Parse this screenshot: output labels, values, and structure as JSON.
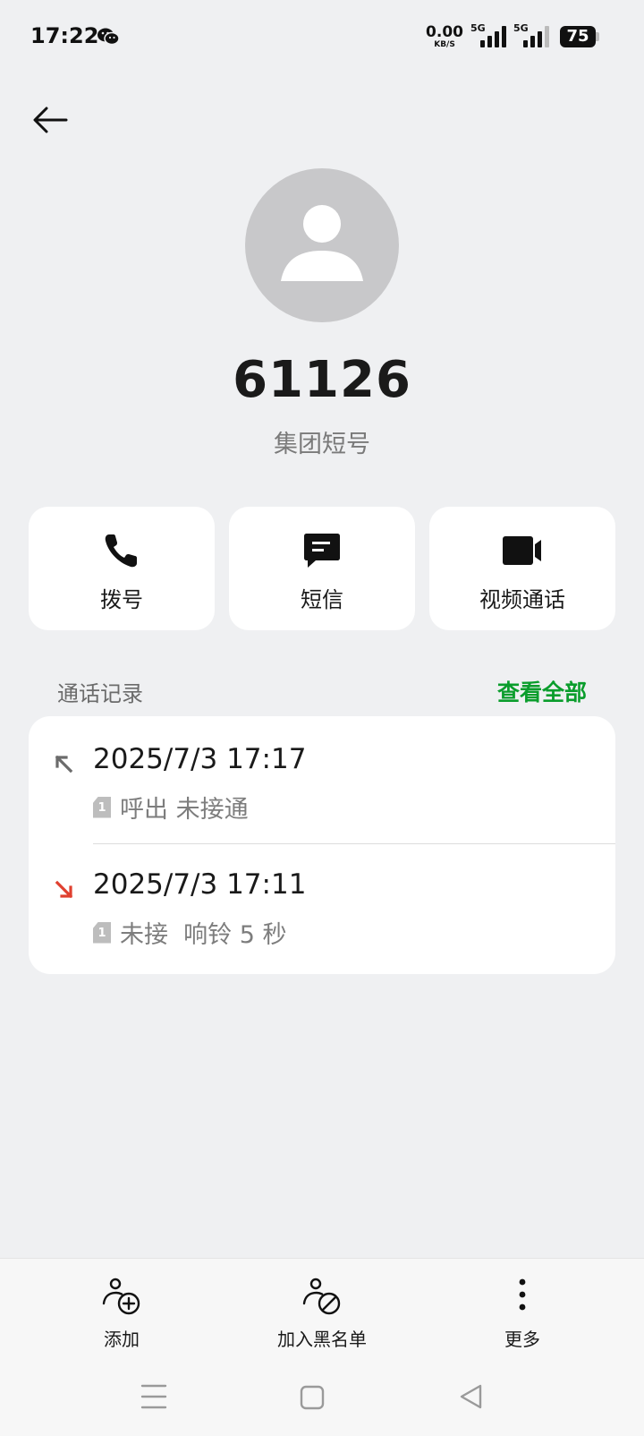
{
  "status_bar": {
    "time": "17:22",
    "net_speed_value": "0.00",
    "net_speed_unit": "KB/S",
    "sim1_net": "5G",
    "sim2_net": "5G",
    "battery": "75"
  },
  "contact": {
    "number": "61126",
    "subtitle": "集团短号"
  },
  "actions": {
    "call": "拨号",
    "sms": "短信",
    "video": "视频通话"
  },
  "call_log": {
    "title": "通话记录",
    "view_all": "查看全部",
    "entries": [
      {
        "datetime": "2025/7/3 17:17",
        "sim": "1",
        "status": "呼出 未接通",
        "direction": "outgoing",
        "color": "#6b6b6b"
      },
      {
        "datetime": "2025/7/3 17:11",
        "sim": "1",
        "status": "未接  响铃 5 秒",
        "direction": "missed",
        "color": "#e0402f"
      }
    ]
  },
  "bottom_bar": {
    "add": "添加",
    "blacklist": "加入黑名单",
    "more": "更多"
  },
  "colors": {
    "accent": "#0a9d2c",
    "missed": "#e0402f",
    "background": "#eff0f2"
  }
}
